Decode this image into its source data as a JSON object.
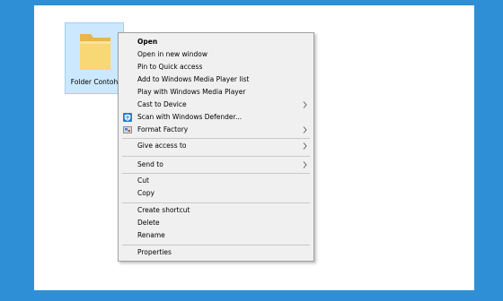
{
  "desktop": {
    "folder": {
      "label": "Folder Contoh",
      "icon": "folder-icon",
      "selected": true
    }
  },
  "context_menu": {
    "items": [
      {
        "label": "Open",
        "bold": true
      },
      {
        "label": "Open in new window"
      },
      {
        "label": "Pin to Quick access"
      },
      {
        "label": "Add to Windows Media Player list"
      },
      {
        "label": "Play with Windows Media Player"
      },
      {
        "label": "Cast to Device",
        "submenu": true
      },
      {
        "label": "Scan with Windows Defender...",
        "icon": "windows-defender-icon"
      },
      {
        "label": "Format Factory",
        "icon": "format-factory-icon",
        "submenu": true
      },
      {
        "label": "Give access to",
        "submenu": true
      },
      {
        "label": "Send to",
        "submenu": true
      },
      {
        "label": "Cut"
      },
      {
        "label": "Copy"
      },
      {
        "label": "Create shortcut"
      },
      {
        "label": "Delete"
      },
      {
        "label": "Rename"
      },
      {
        "label": "Properties"
      }
    ]
  },
  "colors": {
    "background_border": "#2e8fd6",
    "desktop": "#ffffff",
    "selection_fill": "#cce8ff",
    "selection_border": "#99d1ff",
    "menu_background": "#f0f0f0",
    "menu_border": "#a0a0a0",
    "folder_yellow": "#f8d775",
    "defender_blue": "#1e7fd8"
  }
}
